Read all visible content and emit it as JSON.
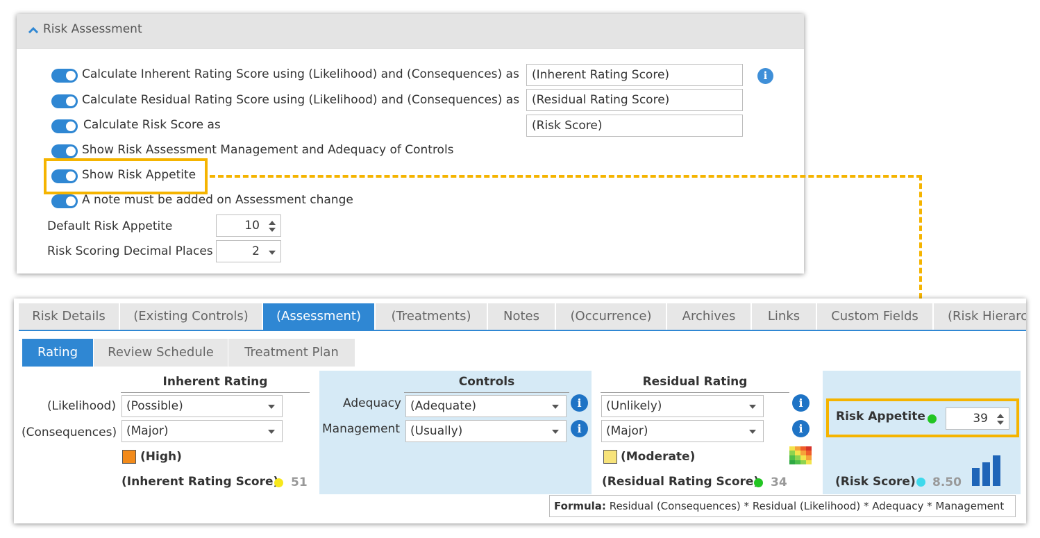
{
  "risk_assessment": {
    "title": "Risk Assessment",
    "options": [
      {
        "label": "Calculate Inherent Rating Score using (Likelihood) and (Consequences) as",
        "enabled": true,
        "value": "(Inherent Rating Score)"
      },
      {
        "label": "Calculate Residual Rating Score using (Likelihood) and (Consequences) as",
        "enabled": true,
        "value": "(Residual Rating Score)"
      },
      {
        "label": "Calculate Risk Score as",
        "enabled": true,
        "value": "(Risk Score)"
      },
      {
        "label": "Show Risk Assessment Management and Adequacy of Controls",
        "enabled": true
      },
      {
        "label": "Show Risk Appetite",
        "enabled": true
      },
      {
        "label": "A note must be added on Assessment change",
        "enabled": true
      }
    ],
    "default_risk_appetite": {
      "label": "Default Risk Appetite",
      "value": "10"
    },
    "decimal_places": {
      "label": "Risk Scoring Decimal Places",
      "value": "2"
    }
  },
  "tabs": [
    "Risk Details",
    "(Existing Controls)",
    "(Assessment)",
    "(Treatments)",
    "Notes",
    "(Occurrence)",
    "Archives",
    "Links",
    "Custom Fields",
    "(Risk Hierarc"
  ],
  "active_tab": "(Assessment)",
  "subtabs": [
    "Rating",
    "Review Schedule",
    "Treatment Plan"
  ],
  "active_subtab": "Rating",
  "inherent": {
    "title": "Inherent Rating",
    "likelihood_label": "(Likelihood)",
    "likelihood": "(Possible)",
    "consequences_label": "(Consequences)",
    "consequences": "(Major)",
    "rating": "(High)",
    "rating_color": "#f28a1a",
    "score_label": "(Inherent Rating Score)",
    "score_dot_color": "#f7e81c",
    "score": "51"
  },
  "controls": {
    "title": "Controls",
    "adequacy_label": "Adequacy",
    "adequacy": "(Adequate)",
    "management_label": "Management",
    "management": "(Usually)"
  },
  "residual": {
    "title": "Residual Rating",
    "likelihood": "(Unlikely)",
    "consequences": "(Major)",
    "rating": "(Moderate)",
    "rating_color": "#f7e37a",
    "score_label": "(Residual Rating Score)",
    "score_dot_color": "#22c522",
    "score": "34"
  },
  "risk": {
    "appetite_label": "Risk Appetite",
    "appetite_dot_color": "#22c522",
    "appetite": "39",
    "score_label": "(Risk Score)",
    "score_dot_color": "#3fd9ec",
    "score": "8.50"
  },
  "formula": {
    "label": "Formula:",
    "text": "Residual (Consequences) * Residual (Likelihood) * Adequacy * Management"
  },
  "colors": {
    "accent": "#2f87d3",
    "highlight": "#f5b400"
  },
  "icons": [
    "chevron-up-icon",
    "info-icon",
    "heatmap-icon",
    "bar-chart-icon"
  ]
}
